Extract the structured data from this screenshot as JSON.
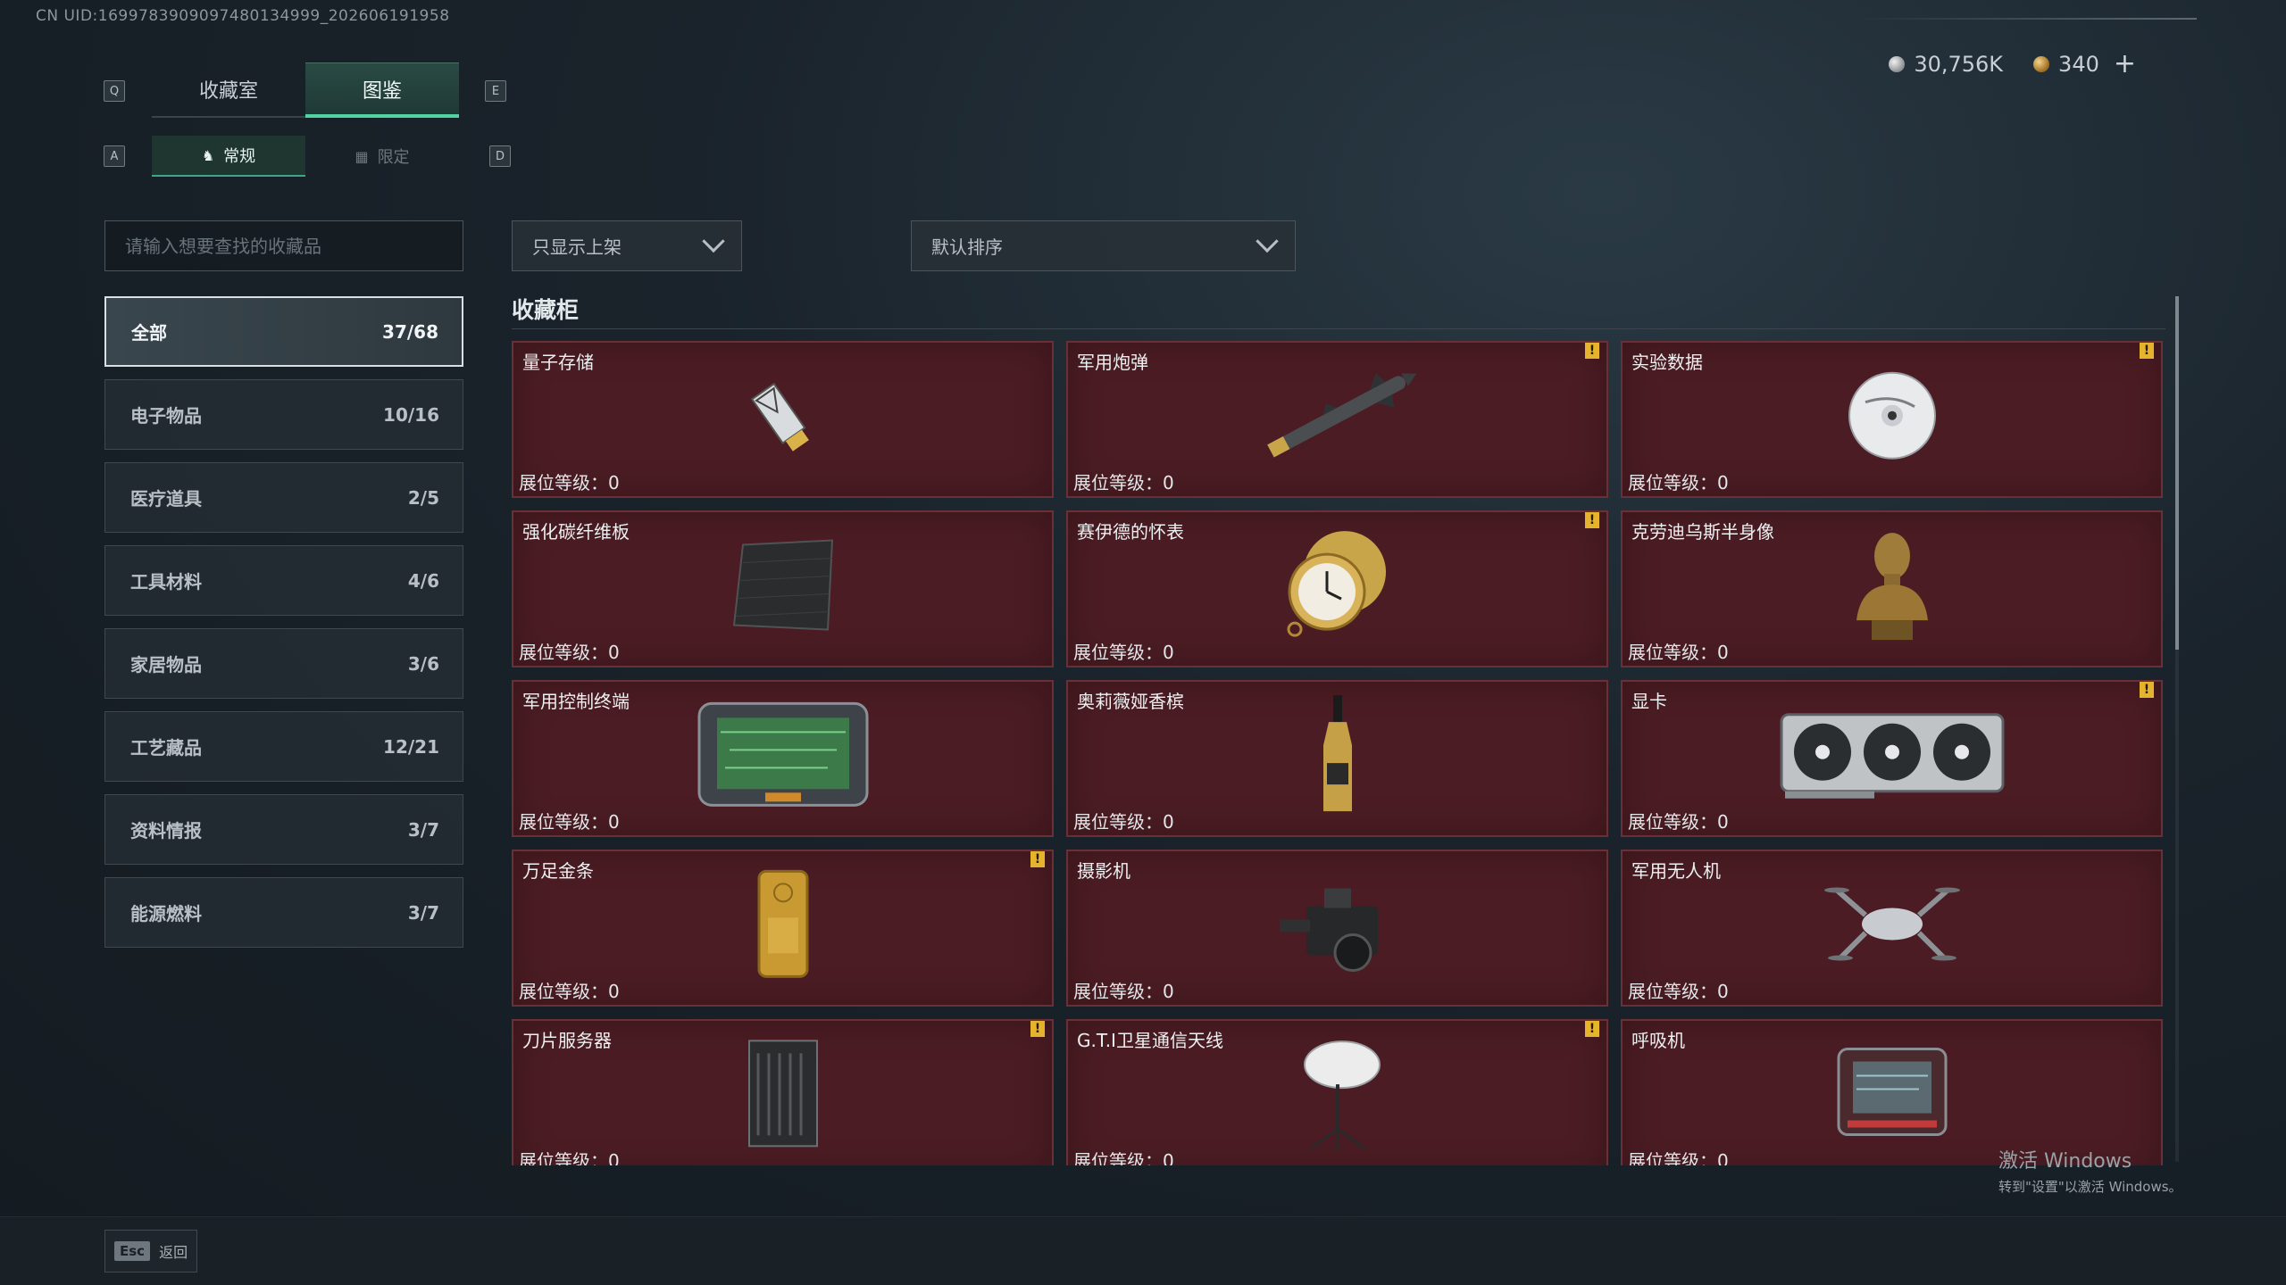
{
  "uid": "CN UID:1699783909097480134999_202606191958",
  "currency": {
    "silver": "30,756K",
    "gold": "340",
    "plus": "+"
  },
  "keys": {
    "left_tab": "Q",
    "right_tab": "E",
    "left_sub": "A",
    "right_sub": "D"
  },
  "tabs": [
    {
      "label": "收藏室"
    },
    {
      "label": "图鉴"
    }
  ],
  "subtabs": [
    {
      "label": "常规",
      "icon": "figure-icon"
    },
    {
      "label": "限定",
      "icon": "image-icon"
    }
  ],
  "search": {
    "placeholder": "请输入想要查找的收藏品"
  },
  "filters": {
    "display": "只显示上架",
    "sort": "默认排序"
  },
  "categories": [
    {
      "label": "全部",
      "count": "37/68"
    },
    {
      "label": "电子物品",
      "count": "10/16"
    },
    {
      "label": "医疗道具",
      "count": "2/5"
    },
    {
      "label": "工具材料",
      "count": "4/6"
    },
    {
      "label": "家居物品",
      "count": "3/6"
    },
    {
      "label": "工艺藏品",
      "count": "12/21"
    },
    {
      "label": "资料情报",
      "count": "3/7"
    },
    {
      "label": "能源燃料",
      "count": "3/7"
    }
  ],
  "section_title": "收藏柜",
  "level_label": "展位等级：0",
  "items": [
    {
      "name": "量子存储",
      "warn": false,
      "art": "usb"
    },
    {
      "name": "军用炮弹",
      "warn": true,
      "art": "missile"
    },
    {
      "name": "实验数据",
      "warn": true,
      "art": "disc"
    },
    {
      "name": "强化碳纤维板",
      "warn": false,
      "art": "carbon"
    },
    {
      "name": "赛伊德的怀表",
      "warn": true,
      "art": "watch"
    },
    {
      "name": "克劳迪乌斯半身像",
      "warn": false,
      "art": "bust"
    },
    {
      "name": "军用控制终端",
      "warn": false,
      "art": "terminal"
    },
    {
      "name": "奥莉薇娅香槟",
      "warn": false,
      "art": "bottle"
    },
    {
      "name": "显卡",
      "warn": true,
      "art": "gpu"
    },
    {
      "name": "万足金条",
      "warn": true,
      "art": "gold"
    },
    {
      "name": "摄影机",
      "warn": false,
      "art": "camera"
    },
    {
      "name": "军用无人机",
      "warn": false,
      "art": "drone"
    },
    {
      "name": "刀片服务器",
      "warn": true,
      "art": "server"
    },
    {
      "name": "G.T.I卫星通信天线",
      "warn": true,
      "art": "antenna"
    },
    {
      "name": "呼吸机",
      "warn": false,
      "art": "ventilator"
    }
  ],
  "warn_glyph": "!",
  "esc": {
    "key": "Esc",
    "label": "返回"
  },
  "watermark": {
    "line1": "激活 Windows",
    "line2": "转到\"设置\"以激活 Windows。"
  }
}
